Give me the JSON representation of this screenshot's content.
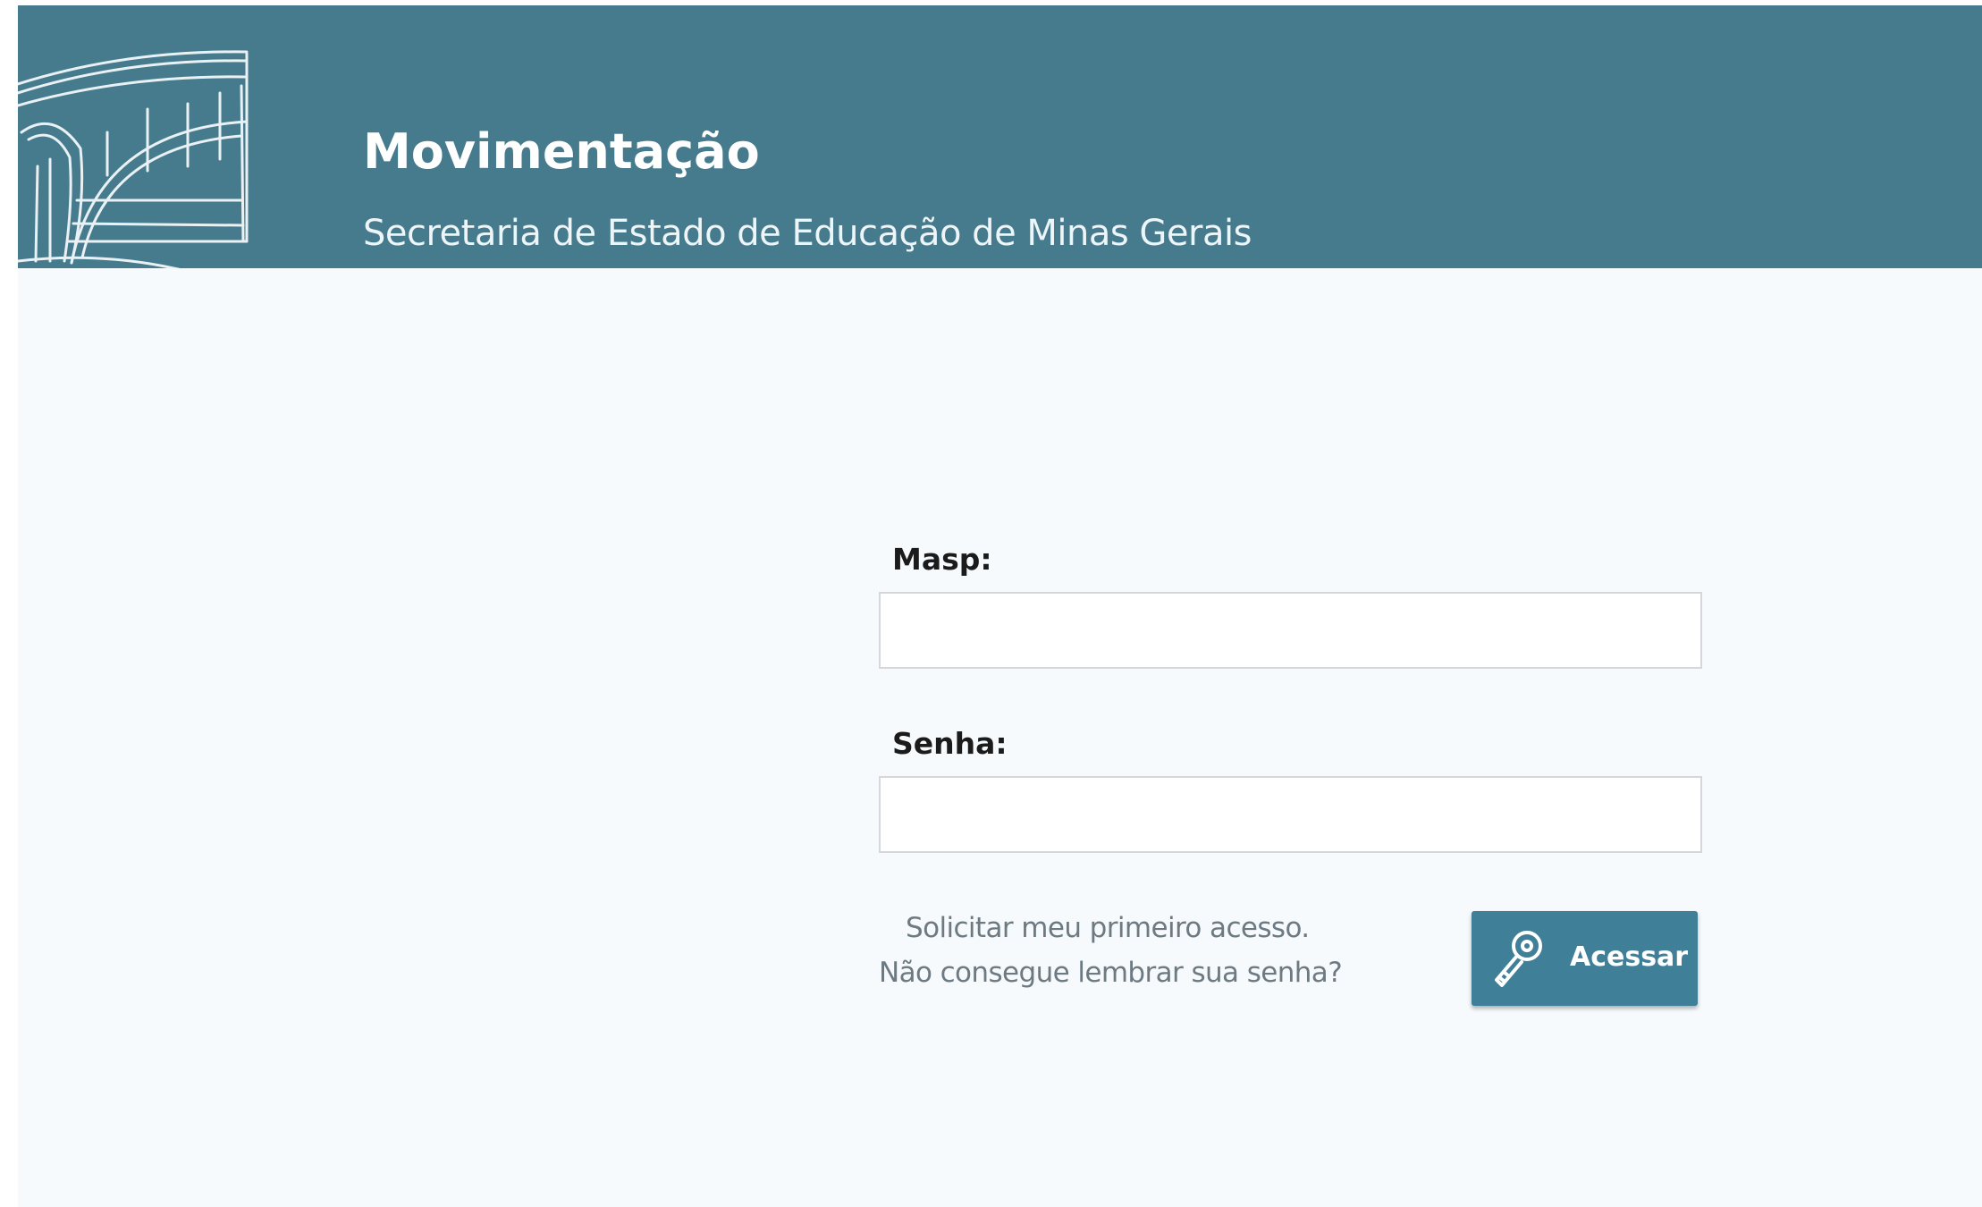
{
  "header": {
    "title": "Movimentação",
    "subtitle": "Secretaria de Estado de Educação de Minas Gerais",
    "logo_icon": "building-arch-sketch-icon",
    "background_color": "#457b8d"
  },
  "login_form": {
    "masp_label": "Masp:",
    "masp_value": "",
    "senha_label": "Senha:",
    "senha_value": "",
    "first_access_link": "Solicitar meu primeiro acesso.",
    "forgot_password_link": "Não consegue lembrar sua senha?",
    "submit_label": "Acessar",
    "submit_icon": "key-icon",
    "button_color": "#3f7f98"
  },
  "page_background": "#f7fafd"
}
